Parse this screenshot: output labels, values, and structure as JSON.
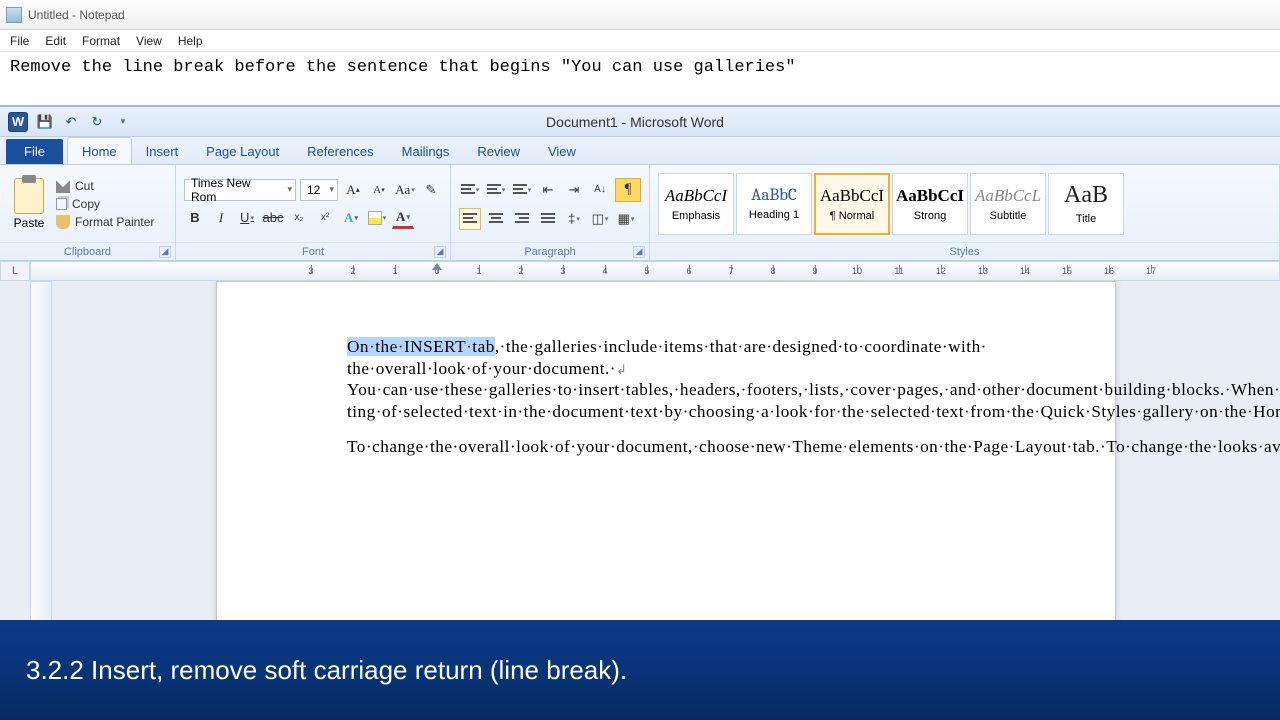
{
  "notepad": {
    "title": "Untitled - Notepad",
    "menu": [
      "File",
      "Edit",
      "Format",
      "View",
      "Help"
    ],
    "content": "Remove the line break before the sentence that begins \"You can use galleries\""
  },
  "word": {
    "title": "Document1 - Microsoft Word",
    "tabs": [
      "File",
      "Home",
      "Insert",
      "Page Layout",
      "References",
      "Mailings",
      "Review",
      "View"
    ],
    "active_tab": "Home",
    "clipboard": {
      "paste": "Paste",
      "cut": "Cut",
      "copy": "Copy",
      "format_painter": "Format Painter",
      "label": "Clipboard"
    },
    "font": {
      "name": "Times New Rom",
      "size": "12",
      "label": "Font"
    },
    "paragraph": {
      "label": "Paragraph"
    },
    "styles": {
      "label": "Styles",
      "items": [
        {
          "sample": "AaBbCcI",
          "name": "Emphasis",
          "cls": "emph"
        },
        {
          "sample": "AaBbC",
          "name": "Heading 1",
          "cls": "h1"
        },
        {
          "sample": "AaBbCcI",
          "name": "¶ Normal",
          "cls": "normal",
          "selected": true
        },
        {
          "sample": "AaBbCcI",
          "name": "Strong",
          "cls": "strong"
        },
        {
          "sample": "AaBbCcL",
          "name": "Subtitle",
          "cls": "sub"
        },
        {
          "sample": "AaB",
          "name": "Title",
          "cls": "title"
        }
      ]
    },
    "doc": {
      "selected": "On·the·INSERT·tab",
      "p1a": ",·the·galleries·include·items·that·are·designed·to·coordinate·with·",
      "p1b": "the·overall·look·of·your·document.·",
      "p2": "You·can·use·these·galleries·to·insert·tables,·headers,·footers,·lists,·cover·pages,·and·other·document·building·blocks.·When·you·create·pictures,·charts,·or·diagrams,·they·also·coordinate·with·your·current·document·look.·You·can·easily·change·the·format-ting·of·selected·text·in·the·document·text·by·choosing·a·look·for·the·selected·text·from·the·Quick·Styles·gallery·on·the·Home·tab.·You·can·also·format·text·directly·by·using·the·other·controls·on·the·Home·tab.·Most·controls·offer·a·choice·of·using·the·look·from·the·current·theme·or·using·a·format·that·you·specify·directly.",
      "p3": "To·change·the·overall·look·of·your·document,·choose·new·Theme·elements·on·the·Page·Layout·tab.·To·change·the·looks·available·in·the·Quick·Style·gallery,·use·the·Change·Current·Quick·Style·Set·command.·Both·the·Themes·gallery·and·the·Quick·"
    }
  },
  "caption": "3.2.2 Insert, remove soft carriage return (line break)."
}
